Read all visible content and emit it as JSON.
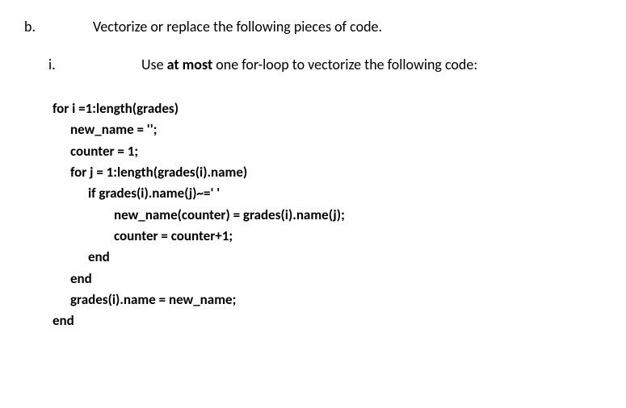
{
  "item_b": {
    "label": "b.",
    "text": "Vectorize or replace the following pieces of code."
  },
  "item_i": {
    "label": "i.",
    "text_before": "Use ",
    "text_bold": "at most",
    "text_after": " one for-loop to vectorize the following code:"
  },
  "code": {
    "l0": "for i =1:length(grades)",
    "l1": "new_name = '';",
    "l2": "counter = 1;",
    "l3": "for j = 1:length(grades(i).name)",
    "l4": "if grades(i).name(j)~=' '",
    "l5": "new_name(counter) = grades(i).name(j);",
    "l6": "counter = counter+1;",
    "l7": "end",
    "l8": "end",
    "l9": "grades(i).name = new_name;",
    "l10": "end"
  }
}
